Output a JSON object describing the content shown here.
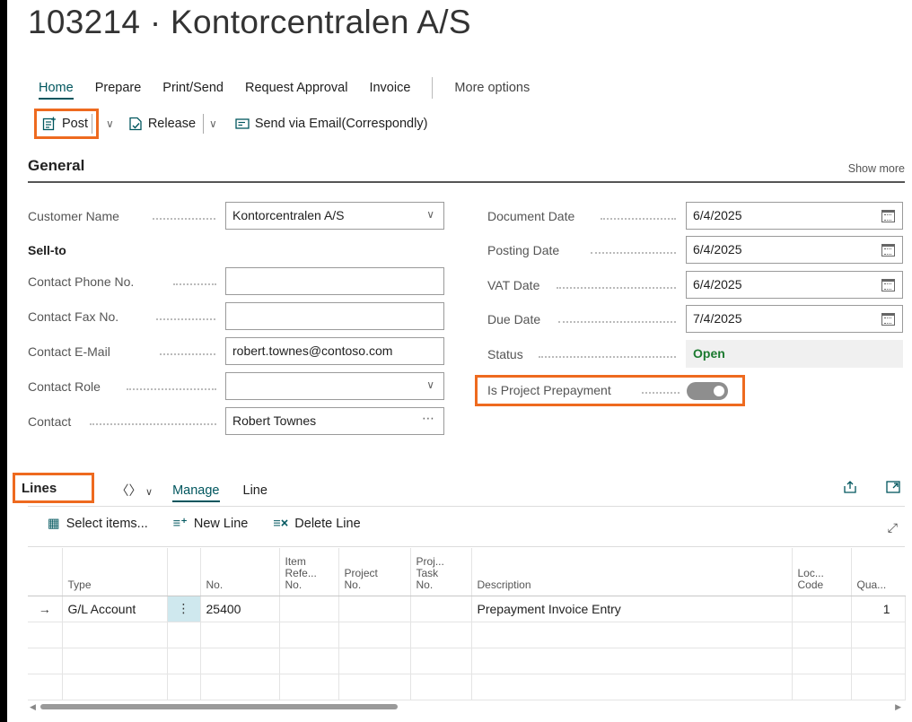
{
  "header": {
    "title": "103214 · Kontorcentralen A/S"
  },
  "tabs": [
    {
      "label": "Home"
    },
    {
      "label": "Prepare"
    },
    {
      "label": "Print/Send"
    },
    {
      "label": "Request Approval"
    },
    {
      "label": "Invoice"
    },
    {
      "label": "More options"
    }
  ],
  "toolbar": {
    "post_label": "Post",
    "release_label": "Release",
    "send_label": "Send via Email(Correspondly)"
  },
  "general": {
    "title": "General",
    "show_more": "Show more",
    "customer_name_label": "Customer Name",
    "customer_name_value": "Kontorcentralen A/S",
    "sell_to_label": "Sell-to",
    "contact_phone_label": "Contact Phone No.",
    "contact_phone_value": "",
    "contact_fax_label": "Contact Fax No.",
    "contact_fax_value": "",
    "contact_email_label": "Contact E-Mail",
    "contact_email_value": "robert.townes@contoso.com",
    "contact_role_label": "Contact Role",
    "contact_role_value": "",
    "contact_label": "Contact",
    "contact_value": "Robert Townes",
    "document_date_label": "Document Date",
    "document_date_value": "6/4/2025",
    "posting_date_label": "Posting Date",
    "posting_date_value": "6/4/2025",
    "vat_date_label": "VAT Date",
    "vat_date_value": "6/4/2025",
    "due_date_label": "Due Date",
    "due_date_value": "7/4/2025",
    "status_label": "Status",
    "status_value": "Open",
    "is_project_prepayment_label": "Is Project Prepayment",
    "is_project_prepayment_on": true
  },
  "lines": {
    "title": "Lines",
    "tabs": [
      {
        "label": "Manage"
      },
      {
        "label": "Line"
      }
    ],
    "select_items_label": "Select items...",
    "new_line_label": "New Line",
    "delete_line_label": "Delete Line",
    "columns": {
      "type": "Type",
      "no": "No.",
      "item_ref_1": "Item",
      "item_ref_2": "Refe...",
      "item_ref_3": "No.",
      "project_1": "Project",
      "project_2": "No.",
      "task_1": "Proj...",
      "task_2": "Task",
      "task_3": "No.",
      "description": "Description",
      "loc_1": "Loc...",
      "loc_2": "Code",
      "qty": "Qua..."
    },
    "rows": [
      {
        "arrow": "→",
        "type": "G/L Account",
        "menu": "⋮",
        "no": "25400",
        "item_ref": "",
        "project": "",
        "task": "",
        "description": "Prepayment Invoice Entry",
        "loc": "",
        "qty": "1"
      }
    ]
  },
  "colors": {
    "accent": "#00565e",
    "highlight": "#ee6a1f",
    "status_open": "#1b7a2f"
  }
}
